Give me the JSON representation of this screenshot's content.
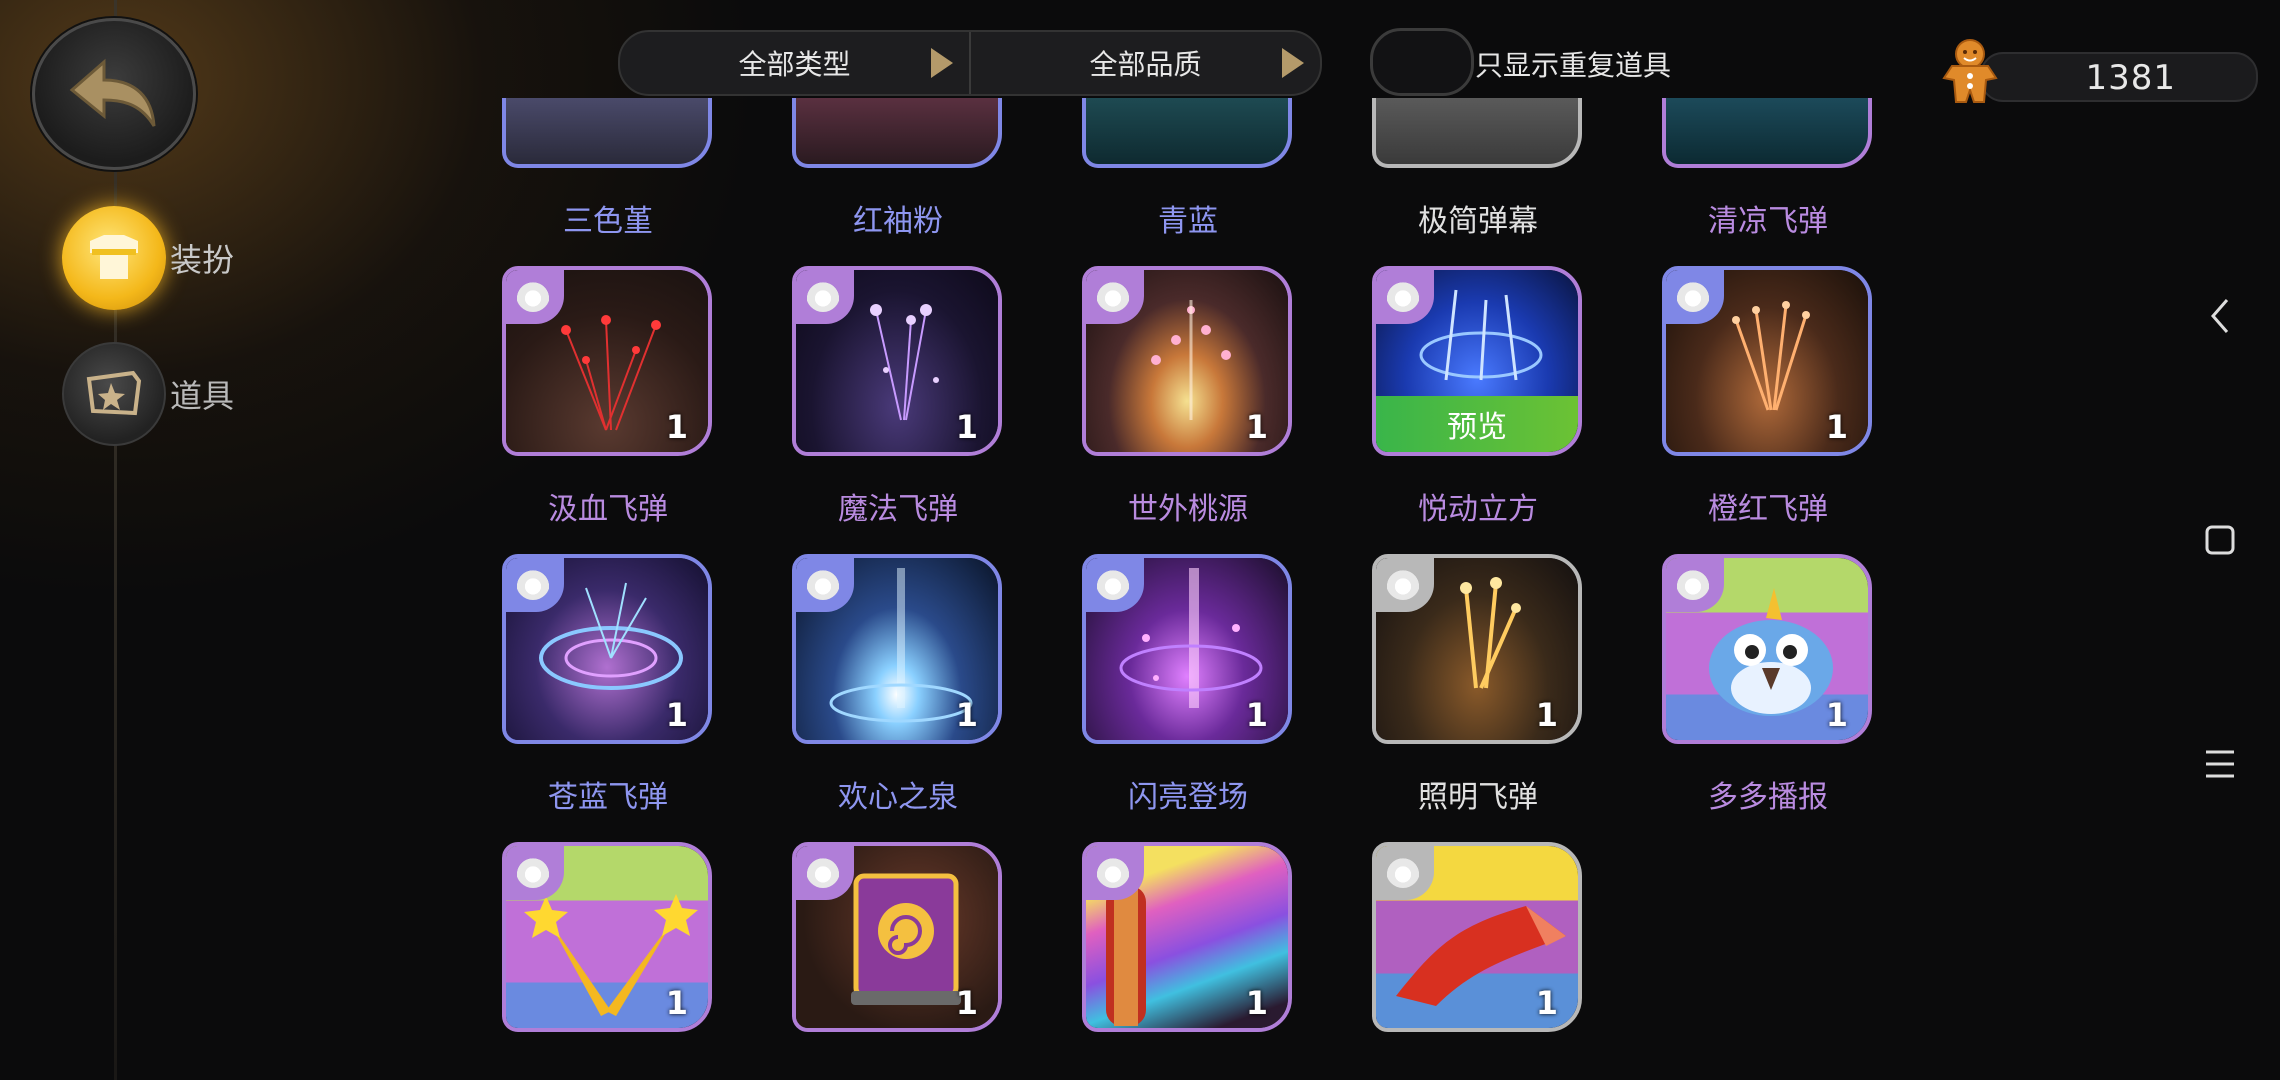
{
  "nav": {
    "items": [
      {
        "label": "装扮",
        "icon": "shirt-icon",
        "active": true
      },
      {
        "label": "道具",
        "icon": "props-icon",
        "active": false
      }
    ]
  },
  "filters": {
    "type_label": "全部类型",
    "quality_label": "全部品质",
    "duplicate_toggle_label": "只显示重复道具"
  },
  "currency": {
    "icon": "gingerbread-icon",
    "value": "1381"
  },
  "colors": {
    "purple": "#b07ed8",
    "blue": "#7f87e6",
    "gray": "#b8b8b8",
    "preview_green": "#4bbf3c",
    "active_gold": "#f4b81a"
  },
  "top_row": [
    {
      "name": "三色堇",
      "rarity": "blue"
    },
    {
      "name": "红袖粉",
      "rarity": "blue"
    },
    {
      "name": "青蓝",
      "rarity": "blue"
    },
    {
      "name": "极简弹幕",
      "rarity": "gray"
    },
    {
      "name": "清凉飞弹",
      "rarity": "purple"
    }
  ],
  "items": [
    {
      "name": "汲血飞弹",
      "rarity": "purple",
      "count": "1",
      "art": "red-fireworks"
    },
    {
      "name": "魔法飞弹",
      "rarity": "purple",
      "count": "1",
      "art": "purple-stars"
    },
    {
      "name": "世外桃源",
      "rarity": "purple",
      "count": "1",
      "art": "peach-blossom"
    },
    {
      "name": "悦动立方",
      "rarity": "purple",
      "count": "",
      "art": "blue-cube",
      "preview": "预览"
    },
    {
      "name": "橙红飞弹",
      "rarity": "blue",
      "count": "1",
      "art": "orange-burst"
    },
    {
      "name": "苍蓝飞弹",
      "rarity": "blue",
      "count": "1",
      "art": "blue-swirl"
    },
    {
      "name": "欢心之泉",
      "rarity": "blue",
      "count": "1",
      "art": "light-fountain"
    },
    {
      "name": "闪亮登场",
      "rarity": "blue",
      "count": "1",
      "art": "purple-beam"
    },
    {
      "name": "照明飞弹",
      "rarity": "gray",
      "count": "1",
      "art": "gold-flare"
    },
    {
      "name": "多多播报",
      "rarity": "purple",
      "count": "1",
      "art": "bird-mascot"
    },
    {
      "name": "",
      "rarity": "purple",
      "count": "1",
      "art": "shooting-stars"
    },
    {
      "name": "",
      "rarity": "purple",
      "count": "1",
      "art": "spell-book"
    },
    {
      "name": "",
      "rarity": "purple",
      "count": "1",
      "art": "rainbow-scroll"
    },
    {
      "name": "",
      "rarity": "gray",
      "count": "1",
      "art": "red-flag"
    }
  ]
}
